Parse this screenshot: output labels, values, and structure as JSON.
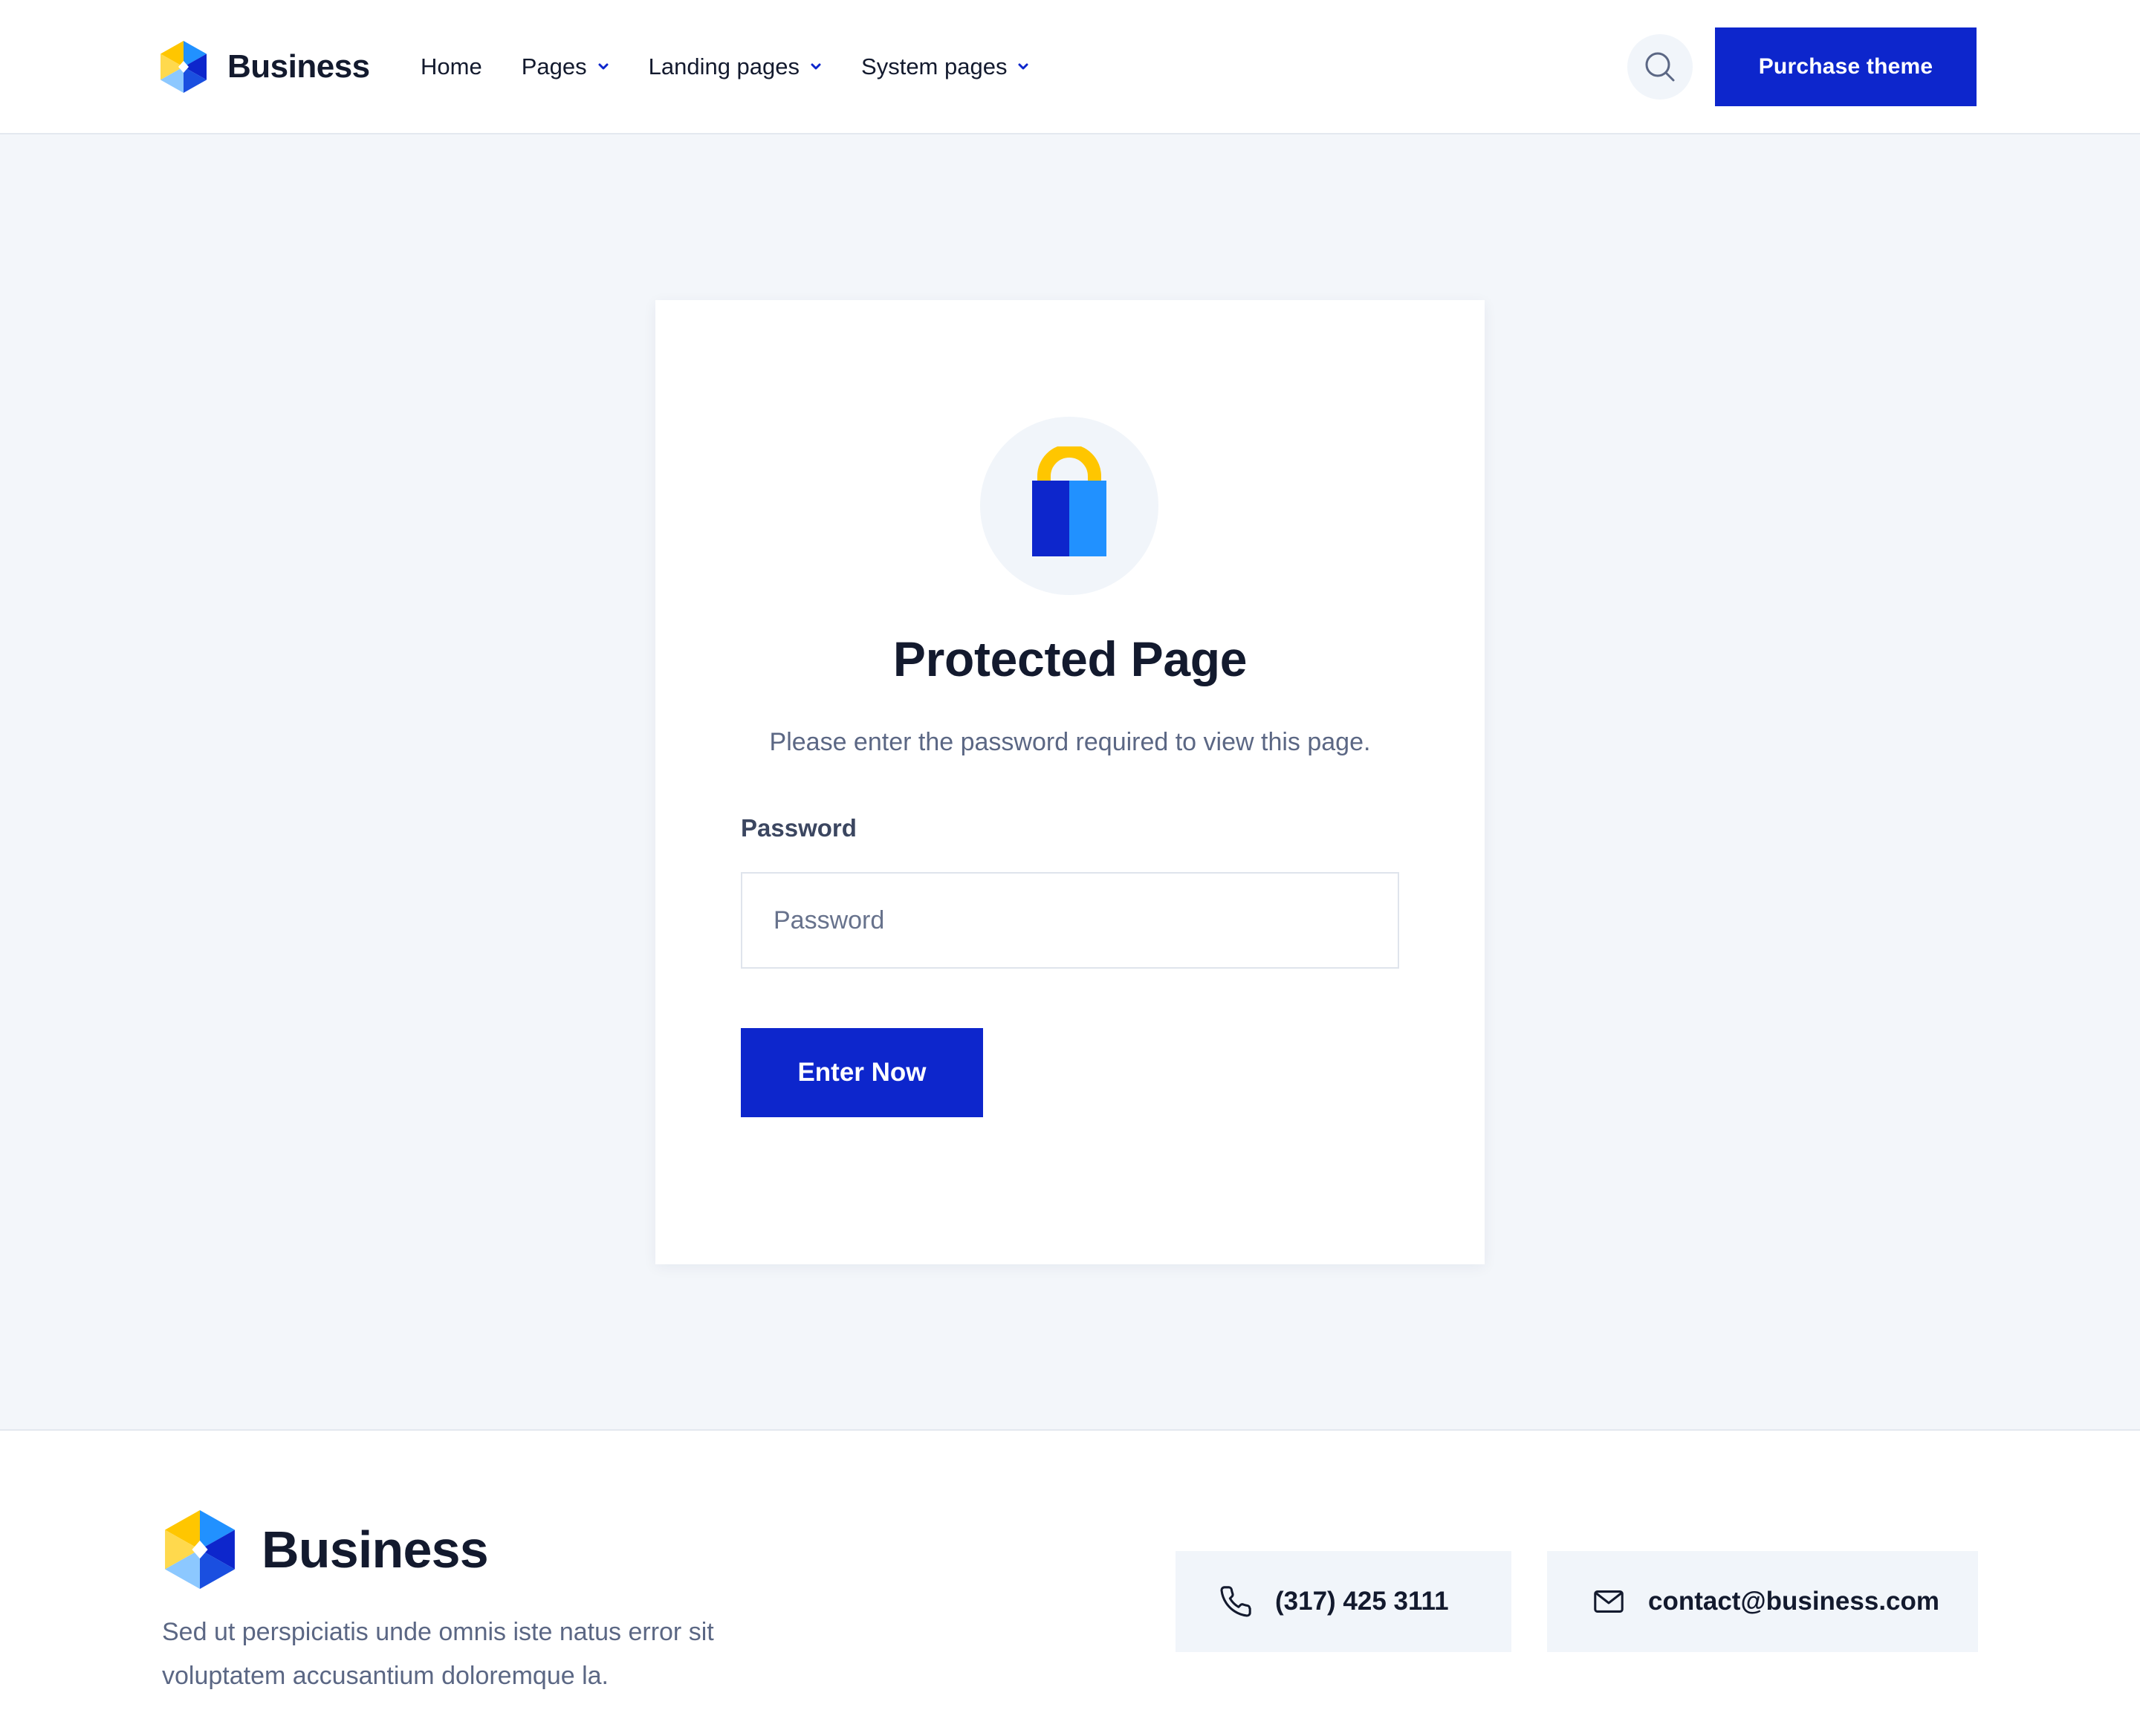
{
  "colors": {
    "accent": "#0d26cc",
    "page_background": "#f3f6fa",
    "text_dark": "#131a2e",
    "text_muted": "#5b6784",
    "logo_yellow": "#ffc600",
    "logo_blue": "#2191ff",
    "logo_dark_blue": "#0d26cc"
  },
  "header": {
    "brand": "Business",
    "nav": [
      {
        "label": "Home",
        "has_dropdown": false
      },
      {
        "label": "Pages",
        "has_dropdown": true
      },
      {
        "label": "Landing pages",
        "has_dropdown": true
      },
      {
        "label": "System pages",
        "has_dropdown": true
      }
    ],
    "search_icon": "search-icon",
    "purchase_label": "Purchase theme"
  },
  "card": {
    "icon": "lock-icon",
    "title": "Protected Page",
    "subtitle": "Please enter the password required to view this page.",
    "password_label": "Password",
    "password_placeholder": "Password",
    "password_value": "",
    "submit_label": "Enter Now"
  },
  "footer": {
    "brand": "Business",
    "description": "Sed ut perspiciatis unde omnis iste natus error sit voluptatem accusantium doloremque la.",
    "phone_icon": "phone-icon",
    "phone": "(317) 425 3111",
    "email_icon": "mail-icon",
    "email": "contact@business.com"
  }
}
